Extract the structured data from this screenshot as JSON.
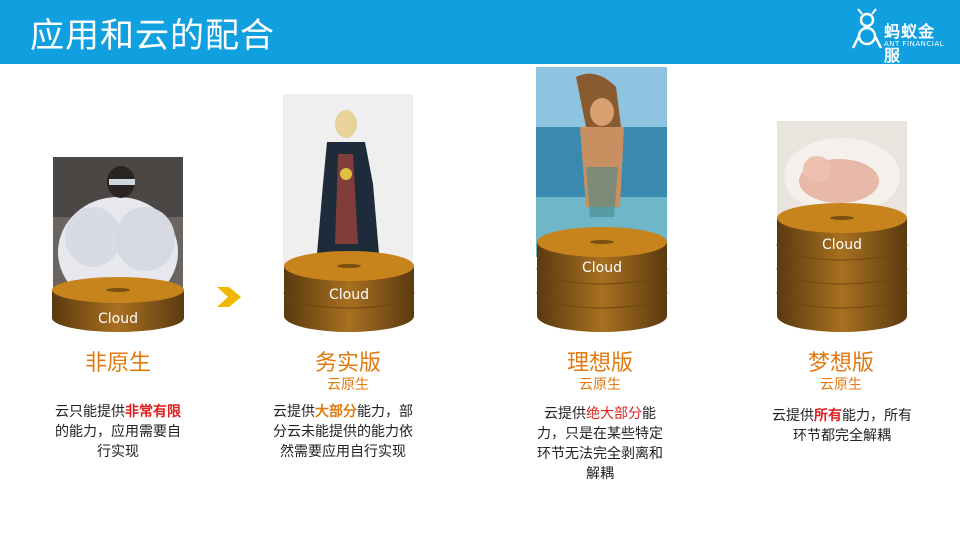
{
  "header": {
    "title": "应用和云的配合",
    "logo_text": "蚂蚁金服",
    "logo_sub": "ANT FINANCIAL",
    "bg_color": "#10a0e0"
  },
  "colors": {
    "accent": "#e07a10",
    "highlight_red": "#e02020",
    "text": "#222222"
  },
  "columns": [
    {
      "cloud_label": "Cloud",
      "title": "非原生",
      "subtitle": "",
      "desc_parts": [
        {
          "text": "云只能提供",
          "hl": ""
        },
        {
          "text": "非常有限",
          "hl": "red"
        },
        {
          "text": "的能力，应用需要自行实现",
          "hl": ""
        }
      ],
      "photo_icon": "person-in-puffer-jacket-photo"
    },
    {
      "cloud_label": "Cloud",
      "title": "务实版",
      "subtitle": "云原生",
      "desc_parts": [
        {
          "text": "云提供",
          "hl": ""
        },
        {
          "text": "大部分",
          "hl": "orange"
        },
        {
          "text": "能力，部分云未能提供的能力依然需要应用自行实现",
          "hl": ""
        }
      ],
      "photo_icon": "woman-in-dress-photo"
    },
    {
      "cloud_label": "Cloud",
      "title": "理想版",
      "subtitle": "云原生",
      "desc_parts": [
        {
          "text": "云提供",
          "hl": ""
        },
        {
          "text": "绝大部分",
          "hl": "red-plain"
        },
        {
          "text": "能力，只是在某些特定环节无法完全剥离和解耦",
          "hl": ""
        }
      ],
      "photo_icon": "woman-on-beach-photo"
    },
    {
      "cloud_label": "Cloud",
      "title": "梦想版",
      "subtitle": "云原生",
      "desc_parts": [
        {
          "text": "云提供",
          "hl": ""
        },
        {
          "text": "所有",
          "hl": "red"
        },
        {
          "text": "能力，所有环节都完全解耦",
          "hl": ""
        }
      ],
      "photo_icon": "sleeping-baby-photo"
    }
  ]
}
